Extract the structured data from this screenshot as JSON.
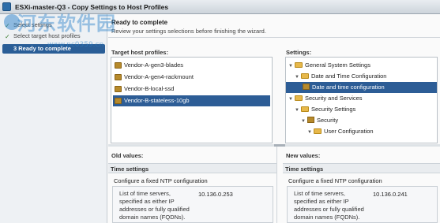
{
  "window": {
    "title": "ESXi-master-Q3 - Copy Settings to Host Profiles"
  },
  "steps": [
    {
      "label": "Select settings"
    },
    {
      "label": "Select target host profiles"
    },
    {
      "label": "3  Ready to complete"
    }
  ],
  "header": {
    "title": "Ready to complete",
    "subtitle": "Review your settings selections before finishing the wizard."
  },
  "target_profiles": {
    "label": "Target host profiles:",
    "items": [
      "Vendor-A-gen3-blades",
      "Vendor-A-gen4-rackmount",
      "Vendor-B-local-ssd",
      "Vendor-B-stateless-10gb"
    ]
  },
  "settings": {
    "label": "Settings:",
    "tree": [
      "General System Settings",
      "Date and Time Configuration",
      "Date and time configuration",
      "Security and Services",
      "Security Settings",
      "Security",
      "User Configuration"
    ]
  },
  "old_values": {
    "label": "Old values:",
    "section": "Time settings",
    "option": "Configure a fixed NTP configuration",
    "desc": "List of time servers, specified as either IP addresses or fully qualified domain names (FQDNs).",
    "value": "10.136.0.253"
  },
  "new_values": {
    "label": "New values:",
    "section": "Time settings",
    "option": "Configure a fixed NTP configuration",
    "desc": "List of time servers, specified as either IP addresses or fully qualified domain names (FQDNs).",
    "value": "10.136.0.241"
  },
  "watermark": {
    "text": "河东软件园",
    "url": "www.pc0359.cn"
  }
}
